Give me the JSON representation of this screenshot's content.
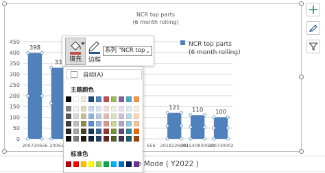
{
  "chart_data": {
    "type": "bar",
    "title": "NCR top parts\n(6 month rolling)",
    "title_line1": "NCR top parts",
    "title_line2": "(6 month rolling)",
    "categories": [
      "200720656",
      "200620",
      "",
      "",
      "",
      "656",
      "2018226001",
      "2015408300",
      "2007300"
    ],
    "category_labels": [
      "200720656",
      "200620",
      "656",
      "2018226001",
      "201540830012",
      "200730002"
    ],
    "series": [
      {
        "name": "NCR top parts (6 month rolling)",
        "values": [
          398,
          330,
          null,
          null,
          null,
          null,
          121,
          110,
          100
        ]
      }
    ],
    "data_labels": [
      "398",
      "33",
      "121",
      "110",
      "100"
    ],
    "ylim": [
      0,
      450
    ],
    "yticks": [
      "0",
      "50",
      "100",
      "150",
      "200",
      "250",
      "300",
      "350",
      "400",
      "450"
    ],
    "grid": true,
    "legend": "right",
    "bar_color": "#4f81bd"
  },
  "legend": {
    "line1": "NCR top parts",
    "line2": "(6 month rolling)"
  },
  "side_buttons": {
    "add_icon": "plus-icon",
    "style_icon": "brush-icon",
    "filter_icon": "filter-icon"
  },
  "toolbar": {
    "fill_label": "填充",
    "outline_label": "边框",
    "series_select_value": "系列 \"NCR top"
  },
  "color_menu": {
    "auto_label": "自动(A)",
    "theme_colors_label": "主题颜色",
    "standard_colors_label": "标准色",
    "theme_top": [
      "#000000",
      "#ffffff",
      "#eeece1",
      "#1f497d",
      "#4f81bd",
      "#c0504d",
      "#9bbb59",
      "#8064a2",
      "#4bacc6",
      "#f79646"
    ],
    "theme_shades": [
      [
        "#7f7f7f",
        "#f2f2f2",
        "#ddd9c3",
        "#c6d9f0",
        "#dbe5f1",
        "#f2dcdb",
        "#ebf1dd",
        "#e5e0ec",
        "#dbeef3",
        "#fdeada"
      ],
      [
        "#595959",
        "#d8d8d8",
        "#c4bd97",
        "#8db3e2",
        "#b8cce4",
        "#e5b9b7",
        "#d7e3bc",
        "#ccc1d9",
        "#b7dde8",
        "#fbd5b5"
      ],
      [
        "#3f3f3f",
        "#bfbfbf",
        "#938953",
        "#548dd4",
        "#95b3d7",
        "#d99694",
        "#c3d69b",
        "#b2a2c7",
        "#92cddc",
        "#fac08f"
      ],
      [
        "#262626",
        "#a5a5a5",
        "#494429",
        "#17365d",
        "#366092",
        "#953734",
        "#76923c",
        "#5f497a",
        "#31859b",
        "#e36c09"
      ],
      [
        "#0c0c0c",
        "#7f7f7f",
        "#1d1b10",
        "#0f243e",
        "#244061",
        "#632423",
        "#4f6128",
        "#3f3151",
        "#205867",
        "#974806"
      ]
    ],
    "standard": [
      "#c00000",
      "#ff0000",
      "#ffc000",
      "#ffff00",
      "#92d050",
      "#00b050",
      "#00b0f0",
      "#0070c0",
      "#002060",
      "#7030a0"
    ]
  },
  "below_chart_text": "e Mode ( Y2022 )"
}
